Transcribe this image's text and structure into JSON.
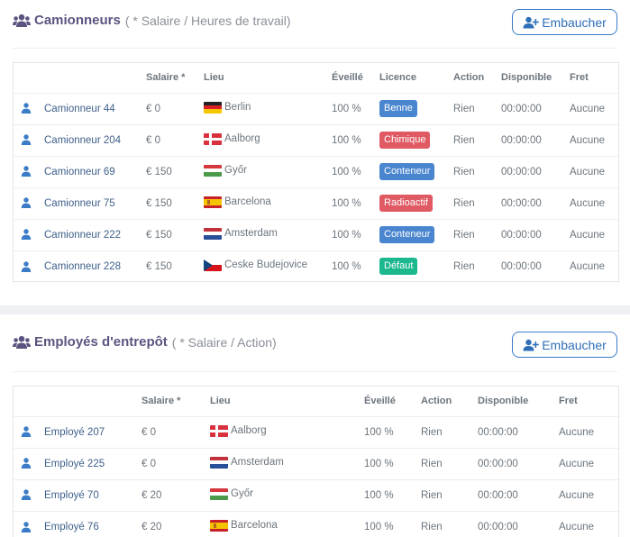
{
  "truckers": {
    "title": "Camionneurs",
    "subtitle": "( * Salaire / Heures de travail)",
    "hire_label": "Embaucher",
    "headers": [
      "Salaire *",
      "Lieu",
      "Éveillé",
      "Licence",
      "Action",
      "Disponible",
      "Fret"
    ],
    "rows": [
      {
        "name": "Camionneur 44",
        "salary": "€ 0",
        "city": "Berlin",
        "flag": "de",
        "awake": "100 %",
        "license": "Benne",
        "license_color": "#4a86cf",
        "action": "Rien",
        "available": "00:00:00",
        "freight": "Aucune"
      },
      {
        "name": "Camionneur 204",
        "salary": "€ 0",
        "city": "Aalborg",
        "flag": "dk",
        "awake": "100 %",
        "license": "Chimique",
        "license_color": "#e05a64",
        "action": "Rien",
        "available": "00:00:00",
        "freight": "Aucune"
      },
      {
        "name": "Camionneur 69",
        "salary": "€ 150",
        "city": "Győr",
        "flag": "hu",
        "awake": "100 %",
        "license": "Conteneur",
        "license_color": "#4a86cf",
        "action": "Rien",
        "available": "00:00:00",
        "freight": "Aucune"
      },
      {
        "name": "Camionneur 75",
        "salary": "€ 150",
        "city": "Barcelona",
        "flag": "es",
        "awake": "100 %",
        "license": "Radioactif",
        "license_color": "#e05a64",
        "action": "Rien",
        "available": "00:00:00",
        "freight": "Aucune"
      },
      {
        "name": "Camionneur 222",
        "salary": "€ 150",
        "city": "Amsterdam",
        "flag": "nl",
        "awake": "100 %",
        "license": "Conteneur",
        "license_color": "#4a86cf",
        "action": "Rien",
        "available": "00:00:00",
        "freight": "Aucune"
      },
      {
        "name": "Camionneur 228",
        "salary": "€ 150",
        "city": "Ceske Budejovice",
        "flag": "cz",
        "awake": "100 %",
        "license": "Défaut",
        "license_color": "#1bb88e",
        "action": "Rien",
        "available": "00:00:00",
        "freight": "Aucune"
      }
    ]
  },
  "warehouse": {
    "title": "Employés d'entrepôt",
    "subtitle": "( * Salaire / Action)",
    "hire_label": "Embaucher",
    "headers": [
      "Salaire *",
      "Lieu",
      "Éveillé",
      "Action",
      "Disponible",
      "Fret"
    ],
    "rows": [
      {
        "name": "Employé 207",
        "salary": "€ 0",
        "city": "Aalborg",
        "flag": "dk",
        "awake": "100 %",
        "action": "Rien",
        "available": "00:00:00",
        "freight": "Aucune"
      },
      {
        "name": "Employé 225",
        "salary": "€ 0",
        "city": "Amsterdam",
        "flag": "nl",
        "awake": "100 %",
        "action": "Rien",
        "available": "00:00:00",
        "freight": "Aucune"
      },
      {
        "name": "Employé 70",
        "salary": "€ 20",
        "city": "Győr",
        "flag": "hu",
        "awake": "100 %",
        "action": "Rien",
        "available": "00:00:00",
        "freight": "Aucune"
      },
      {
        "name": "Employé 76",
        "salary": "€ 20",
        "city": "Barcelona",
        "flag": "es",
        "awake": "100 %",
        "action": "Rien",
        "available": "00:00:00",
        "freight": "Aucune"
      }
    ]
  },
  "colors": {
    "accent": "#2f6fb8",
    "title": "#5c5480",
    "person_icon": "#3a7cc6"
  }
}
